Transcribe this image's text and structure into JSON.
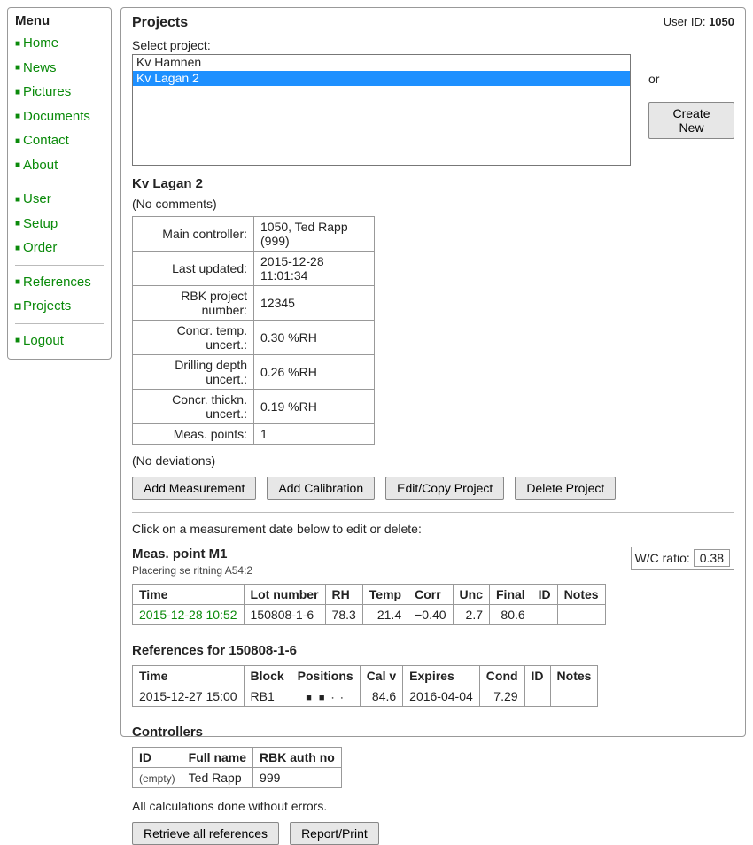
{
  "menu": {
    "title": "Menu",
    "group1": [
      {
        "label": "Home"
      },
      {
        "label": "News"
      },
      {
        "label": "Pictures"
      },
      {
        "label": "Documents"
      },
      {
        "label": "Contact"
      },
      {
        "label": "About"
      }
    ],
    "group2": [
      {
        "label": "User"
      },
      {
        "label": "Setup"
      },
      {
        "label": "Order"
      }
    ],
    "group3": [
      {
        "label": "References",
        "active": false
      },
      {
        "label": "Projects",
        "active": true
      }
    ],
    "group4": [
      {
        "label": "Logout"
      }
    ]
  },
  "header": {
    "title": "Projects",
    "user_id_label": "User ID: ",
    "user_id_value": "1050"
  },
  "project_select": {
    "label": "Select project:",
    "items": [
      {
        "name": "Kv Hamnen",
        "selected": false
      },
      {
        "name": "Kv Lagan 2",
        "selected": true
      }
    ],
    "or_label": "or",
    "create_new_label": "Create New"
  },
  "project": {
    "name": "Kv Lagan 2",
    "no_comments": "(No comments)",
    "details": [
      {
        "k": "Main controller:",
        "v": "1050, Ted Rapp (999)"
      },
      {
        "k": "Last updated:",
        "v": "2015-12-28 11:01:34"
      },
      {
        "k": "RBK project number:",
        "v": "12345"
      },
      {
        "k": "Concr. temp. uncert.:",
        "v": "0.30 %RH"
      },
      {
        "k": "Drilling depth uncert.:",
        "v": "0.26 %RH"
      },
      {
        "k": "Concr. thickn. uncert.:",
        "v": "0.19 %RH"
      },
      {
        "k": "Meas. points:",
        "v": "1"
      }
    ],
    "no_deviations": "(No deviations)",
    "buttons": {
      "add_measurement": "Add Measurement",
      "add_calibration": "Add Calibration",
      "edit_copy": "Edit/Copy Project",
      "delete": "Delete Project"
    },
    "instruction": "Click on a measurement date below to edit or delete:"
  },
  "meas_point": {
    "title": "Meas. point M1",
    "subtitle": "Placering se ritning A54:2",
    "wc_label": "W/C ratio:",
    "wc_value": "0.38",
    "columns": [
      "Time",
      "Lot number",
      "RH",
      "Temp",
      "Corr",
      "Unc",
      "Final",
      "ID",
      "Notes"
    ],
    "row": {
      "time": "2015-12-28 10:52",
      "lot": "150808-1-6",
      "rh": "78.3",
      "temp": "21.4",
      "corr": "−0.40",
      "unc": "2.7",
      "final": "80.6",
      "id": "",
      "notes": ""
    }
  },
  "references": {
    "title": "References for 150808-1-6",
    "columns": [
      "Time",
      "Block",
      "Positions",
      "Cal v",
      "Expires",
      "Cond",
      "ID",
      "Notes"
    ],
    "row": {
      "time": "2015-12-27 15:00",
      "block": "RB1",
      "positions": [
        true,
        true,
        false,
        false
      ],
      "calv": "84.6",
      "expires": "2016-04-04",
      "cond": "7.29",
      "id": "",
      "notes": ""
    }
  },
  "controllers": {
    "title": "Controllers",
    "columns": [
      "ID",
      "Full name",
      "RBK auth no"
    ],
    "row": {
      "id": "(empty)",
      "name": "Ted Rapp",
      "auth": "999"
    }
  },
  "footer": {
    "calc_msg": "All calculations done without errors.",
    "retrieve_label": "Retrieve all references",
    "report_label": "Report/Print"
  }
}
